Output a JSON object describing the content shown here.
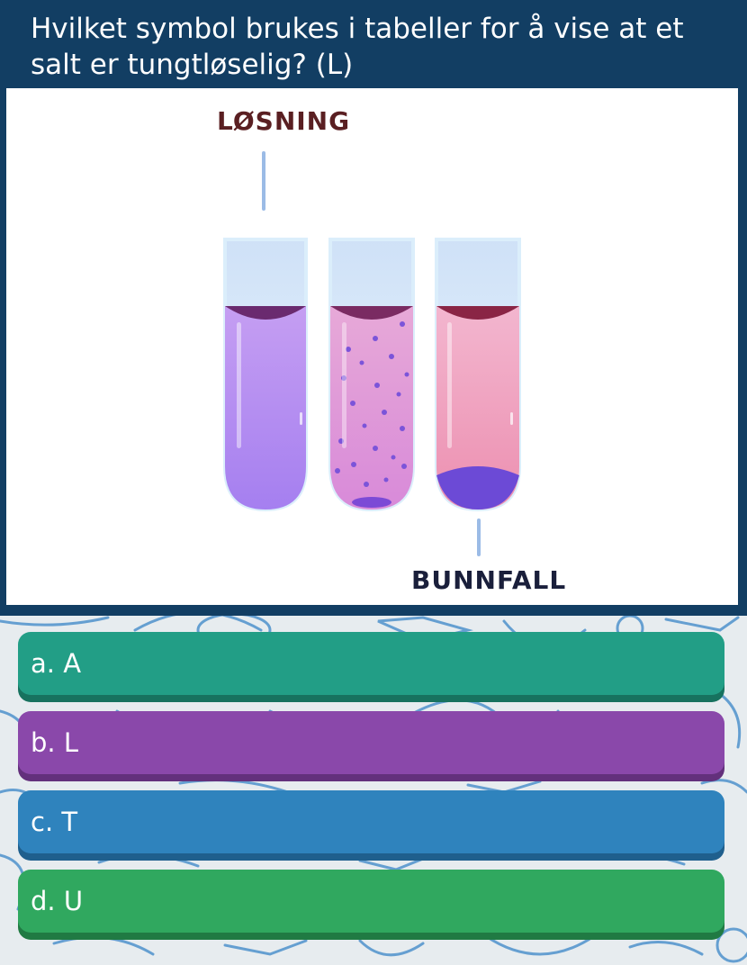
{
  "question": {
    "text": "Hvilket symbol brukes i tabeller for å vise at et salt er tungtløselig? (L)"
  },
  "illustration": {
    "label_top": "LØSNING",
    "label_bottom": "BUNNFALL"
  },
  "answers": [
    {
      "label": "a. A",
      "color": "#229e86",
      "shadow": "#17725f"
    },
    {
      "label": "b. L",
      "color": "#8a48aa",
      "shadow": "#63307c"
    },
    {
      "label": "c. T",
      "color": "#2f83bd",
      "shadow": "#1f5f8d"
    },
    {
      "label": "d. U",
      "color": "#30a85f",
      "shadow": "#207a43"
    }
  ],
  "colors": {
    "header_bg": "#123e63",
    "page_bg": "#e7ecef",
    "doodle": "#3a86c7"
  }
}
